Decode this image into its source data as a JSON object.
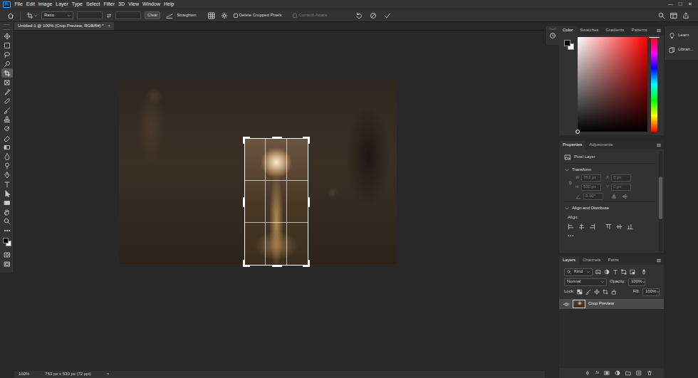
{
  "app": {
    "logo": "Ps"
  },
  "menu": [
    "File",
    "Edit",
    "Image",
    "Layer",
    "Type",
    "Select",
    "Filter",
    "3D",
    "View",
    "Window",
    "Help"
  ],
  "window_controls": [
    "—",
    "☐",
    "✕"
  ],
  "options_bar": {
    "ratio": "Ratio",
    "clear": "Clear",
    "straighten": "Straighten",
    "delete_cropped": {
      "label": "Delete Cropped Pixels",
      "checked": false
    },
    "content_aware": {
      "label": "Content-Aware",
      "checked": false,
      "disabled": true
    }
  },
  "document_tab": {
    "title": "Untitled-1 @ 100% (Crop Preview, RGB/8#) *",
    "close": "×"
  },
  "tools": [
    {
      "selected": false
    },
    {
      "selected": false
    },
    {
      "selected": false
    },
    {
      "selected": false
    },
    {
      "selected": true
    },
    {
      "selected": false
    },
    {
      "selected": false
    },
    {
      "selected": false
    },
    {
      "selected": false
    },
    {
      "selected": false
    },
    {
      "selected": false
    },
    {
      "selected": false
    },
    {
      "selected": false
    },
    {
      "selected": false
    },
    {
      "selected": false
    },
    {
      "selected": false
    },
    {
      "selected": false
    },
    {
      "selected": false
    },
    {
      "selected": false
    },
    {
      "selected": false
    },
    {
      "selected": false
    },
    {
      "selected": false
    }
  ],
  "color_panel": {
    "tabs": [
      {
        "label": "Color",
        "selected": true
      },
      {
        "label": "Swatches",
        "selected": false
      },
      {
        "label": "Gradients",
        "selected": false
      },
      {
        "label": "Patterns",
        "selected": false
      }
    ],
    "hue_level": 1,
    "brightness_level": 0
  },
  "properties_panel": {
    "tabs": [
      {
        "label": "Properties",
        "selected": true
      },
      {
        "label": "Adjustments",
        "selected": false
      }
    ],
    "layer_kind": "Pixel Layer",
    "transform": {
      "title": "Transform",
      "expanded": true,
      "disabled": true,
      "fields": [
        {
          "label": "W",
          "value": "763 px"
        },
        {
          "label": "X",
          "value": "0 px"
        },
        {
          "label": "H",
          "value": "530 px"
        },
        {
          "label": "Y",
          "value": "0 px"
        }
      ],
      "angle": "0.00°"
    },
    "align": {
      "title": "Align and Distribute",
      "expanded": true,
      "label": "Align:",
      "more": "•••"
    }
  },
  "layers_panel": {
    "tabs": [
      {
        "label": "Layers",
        "selected": true
      },
      {
        "label": "Channels",
        "selected": false
      },
      {
        "label": "Paths",
        "selected": false
      }
    ],
    "filter_kind": "Kind",
    "blend_mode": "Normal",
    "opacity_label": "Opacity:",
    "opacity": "100%",
    "lock_label": "Lock:",
    "fill_label": "Fill:",
    "fill": "100%",
    "layers": [
      {
        "name": "Crop Preview",
        "visible": true,
        "selected": true
      }
    ],
    "footer_fx": "fx"
  },
  "right_panels": [
    {
      "label": "Learn"
    },
    {
      "label": "Librari..."
    }
  ],
  "status_bar": {
    "zoom": "100%",
    "info": "763 px x 530 px (72 ppi)",
    "more": ">"
  }
}
